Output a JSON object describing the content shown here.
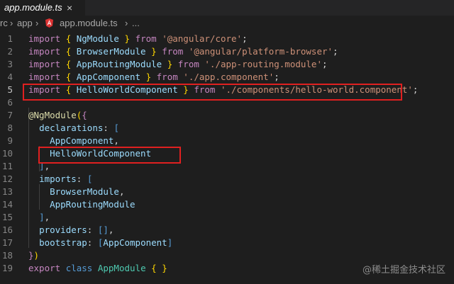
{
  "tab": {
    "title": "app.module.ts",
    "close": "×"
  },
  "breadcrumb": {
    "items": [
      "rc",
      "app",
      "app.module.ts",
      "..."
    ],
    "sep": "›"
  },
  "editor": {
    "lines": [
      {
        "n": "1",
        "tokens": [
          [
            "kw",
            "import"
          ],
          [
            "pl",
            " "
          ],
          [
            "br",
            "{"
          ],
          [
            "pl",
            " "
          ],
          [
            "id",
            "NgModule"
          ],
          [
            "pl",
            " "
          ],
          [
            "br",
            "}"
          ],
          [
            "pl",
            " "
          ],
          [
            "kw",
            "from"
          ],
          [
            "pl",
            " "
          ],
          [
            "str",
            "'@angular/core'"
          ],
          [
            "pl",
            ";"
          ]
        ]
      },
      {
        "n": "2",
        "tokens": [
          [
            "kw",
            "import"
          ],
          [
            "pl",
            " "
          ],
          [
            "br",
            "{"
          ],
          [
            "pl",
            " "
          ],
          [
            "id",
            "BrowserModule"
          ],
          [
            "pl",
            " "
          ],
          [
            "br",
            "}"
          ],
          [
            "pl",
            " "
          ],
          [
            "kw",
            "from"
          ],
          [
            "pl",
            " "
          ],
          [
            "str",
            "'@angular/platform-browser'"
          ],
          [
            "pl",
            ";"
          ]
        ]
      },
      {
        "n": "3",
        "tokens": [
          [
            "kw",
            "import"
          ],
          [
            "pl",
            " "
          ],
          [
            "br",
            "{"
          ],
          [
            "pl",
            " "
          ],
          [
            "id",
            "AppRoutingModule"
          ],
          [
            "pl",
            " "
          ],
          [
            "br",
            "}"
          ],
          [
            "pl",
            " "
          ],
          [
            "kw",
            "from"
          ],
          [
            "pl",
            " "
          ],
          [
            "str",
            "'./app-routing.module'"
          ],
          [
            "pl",
            ";"
          ]
        ]
      },
      {
        "n": "4",
        "tokens": [
          [
            "kw",
            "import"
          ],
          [
            "pl",
            " "
          ],
          [
            "br",
            "{"
          ],
          [
            "pl",
            " "
          ],
          [
            "id",
            "AppComponent"
          ],
          [
            "pl",
            " "
          ],
          [
            "br",
            "}"
          ],
          [
            "pl",
            " "
          ],
          [
            "kw",
            "from"
          ],
          [
            "pl",
            " "
          ],
          [
            "str",
            "'./app.component'"
          ],
          [
            "pl",
            ";"
          ]
        ]
      },
      {
        "n": "5",
        "tokens": [
          [
            "kw",
            "import"
          ],
          [
            "pl",
            " "
          ],
          [
            "br",
            "{"
          ],
          [
            "pl",
            " "
          ],
          [
            "id",
            "HelloWorldComponent"
          ],
          [
            "pl",
            " "
          ],
          [
            "br",
            "}"
          ],
          [
            "pl",
            " "
          ],
          [
            "kw",
            "from"
          ],
          [
            "pl",
            " "
          ],
          [
            "str",
            "'./components/hello-world.component'"
          ],
          [
            "pl",
            ";"
          ]
        ]
      },
      {
        "n": "6",
        "tokens": []
      },
      {
        "n": "7",
        "tokens": [
          [
            "fn",
            "@NgModule"
          ],
          [
            "br",
            "("
          ],
          [
            "kw",
            "{"
          ]
        ]
      },
      {
        "n": "8",
        "tokens": [
          [
            "pl",
            "  "
          ],
          [
            "id",
            "declarations"
          ],
          [
            "pl",
            ": "
          ],
          [
            "bl",
            "["
          ]
        ]
      },
      {
        "n": "9",
        "tokens": [
          [
            "pl",
            "    "
          ],
          [
            "id",
            "AppComponent"
          ],
          [
            "pl",
            ","
          ]
        ]
      },
      {
        "n": "10",
        "tokens": [
          [
            "pl",
            "    "
          ],
          [
            "id",
            "HelloWorldComponent"
          ]
        ]
      },
      {
        "n": "11",
        "tokens": [
          [
            "pl",
            "  "
          ],
          [
            "bl",
            "]"
          ],
          [
            "pl",
            ","
          ]
        ]
      },
      {
        "n": "12",
        "tokens": [
          [
            "pl",
            "  "
          ],
          [
            "id",
            "imports"
          ],
          [
            "pl",
            ": "
          ],
          [
            "bl",
            "["
          ]
        ]
      },
      {
        "n": "13",
        "tokens": [
          [
            "pl",
            "    "
          ],
          [
            "id",
            "BrowserModule"
          ],
          [
            "pl",
            ","
          ]
        ]
      },
      {
        "n": "14",
        "tokens": [
          [
            "pl",
            "    "
          ],
          [
            "id",
            "AppRoutingModule"
          ]
        ]
      },
      {
        "n": "15",
        "tokens": [
          [
            "pl",
            "  "
          ],
          [
            "bl",
            "]"
          ],
          [
            "pl",
            ","
          ]
        ]
      },
      {
        "n": "16",
        "tokens": [
          [
            "pl",
            "  "
          ],
          [
            "id",
            "providers"
          ],
          [
            "pl",
            ": "
          ],
          [
            "bl",
            "[]"
          ],
          [
            "pl",
            ","
          ]
        ]
      },
      {
        "n": "17",
        "tokens": [
          [
            "pl",
            "  "
          ],
          [
            "id",
            "bootstrap"
          ],
          [
            "pl",
            ": "
          ],
          [
            "bl",
            "["
          ],
          [
            "id",
            "AppComponent"
          ],
          [
            "bl",
            "]"
          ]
        ]
      },
      {
        "n": "18",
        "tokens": [
          [
            "kw",
            "}"
          ],
          [
            "br",
            ")"
          ]
        ]
      },
      {
        "n": "19",
        "tokens": [
          [
            "kw",
            "export"
          ],
          [
            "pl",
            " "
          ],
          [
            "bl",
            "class"
          ],
          [
            "pl",
            " "
          ],
          [
            "cls",
            "AppModule"
          ],
          [
            "pl",
            " "
          ],
          [
            "br",
            "{"
          ],
          [
            "pl",
            " "
          ],
          [
            "br",
            "}"
          ]
        ]
      }
    ]
  },
  "watermark": "@稀土掘金技术社区",
  "colors": {
    "background": "#1e1e1e",
    "highlight_box": "#e02020",
    "keyword": "#c586c0",
    "string": "#ce9178",
    "identifier": "#9cdcfe"
  }
}
